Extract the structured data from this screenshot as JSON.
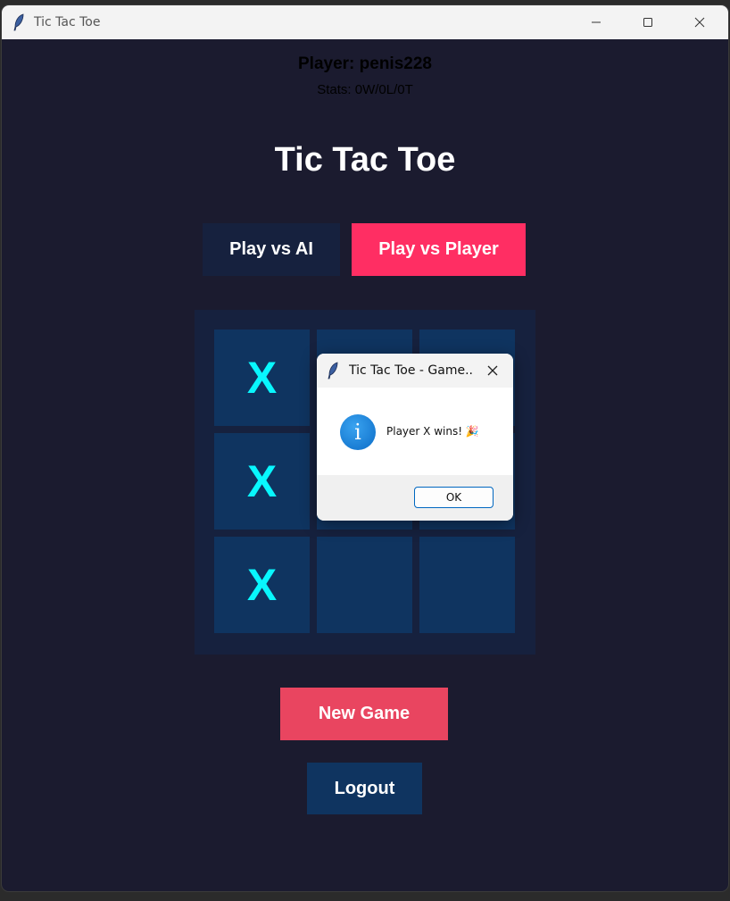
{
  "window": {
    "title": "Tic Tac Toe"
  },
  "header": {
    "player": "Player: penis228",
    "stats": "Stats: 0W/0L/0T"
  },
  "main": {
    "title": "Tic Tac Toe",
    "mode_ai": "Play vs AI",
    "mode_pvp": "Play vs Player"
  },
  "board": {
    "cells": [
      "X",
      "",
      "",
      "X",
      "",
      "",
      "X",
      "",
      ""
    ],
    "mark_color": "#08f7fe"
  },
  "actions": {
    "new_game": "New Game",
    "logout": "Logout"
  },
  "dialog": {
    "title": "Tic Tac Toe - Game...",
    "message": "Player X wins! 🎉",
    "ok": "OK",
    "icon": "info-icon"
  },
  "colors": {
    "background": "#1b1b2f",
    "panel": "#16213e",
    "cell": "#0f3460",
    "accent_pink": "#ff2e63",
    "accent_red": "#e94560"
  }
}
